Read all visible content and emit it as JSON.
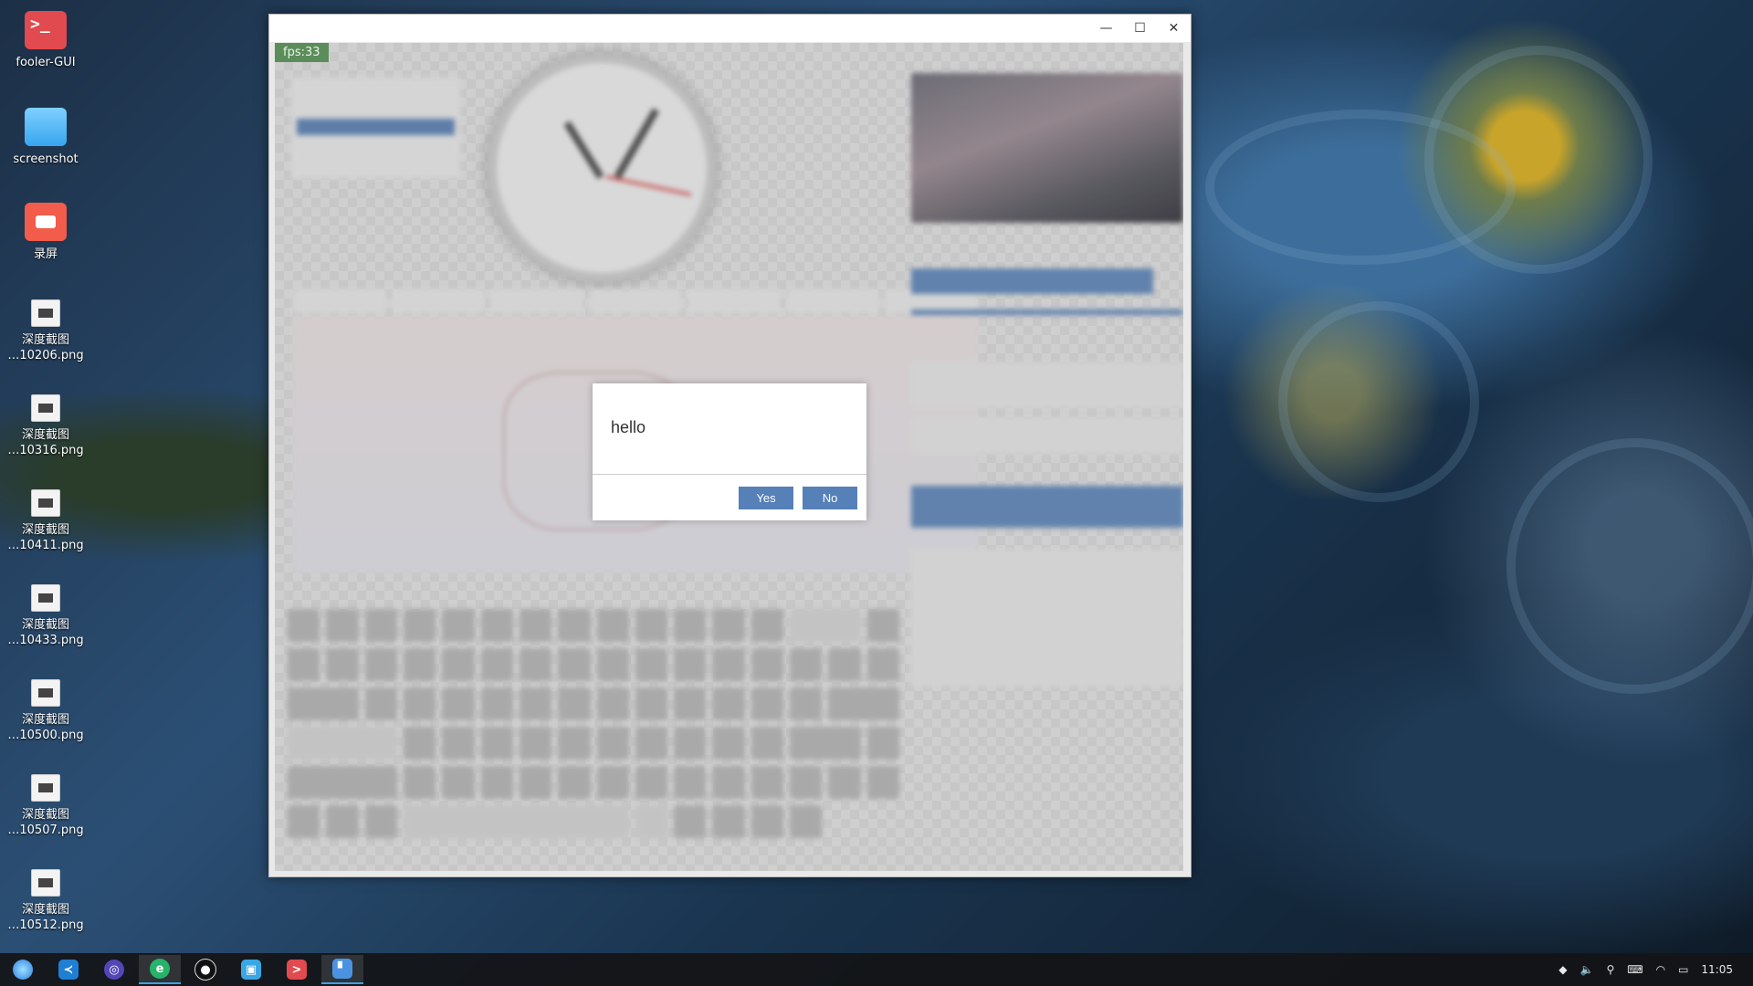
{
  "desktop": {
    "icons": [
      {
        "label_1": "fooler-GUI",
        "label_2": ""
      },
      {
        "label_1": "screenshot",
        "label_2": ""
      },
      {
        "label_1": "录屏",
        "label_2": ""
      },
      {
        "label_1": "深度截图",
        "label_2": "…10206.png"
      },
      {
        "label_1": "深度截图",
        "label_2": "…10316.png"
      },
      {
        "label_1": "深度截图",
        "label_2": "…10411.png"
      },
      {
        "label_1": "深度截图",
        "label_2": "…10433.png"
      },
      {
        "label_1": "深度截图",
        "label_2": "…10500.png"
      },
      {
        "label_1": "深度截图",
        "label_2": "…10507.png"
      },
      {
        "label_1": "深度截图",
        "label_2": "…10512.png"
      }
    ]
  },
  "window": {
    "minimize_glyph": "—",
    "maximize_glyph": "☐",
    "close_glyph": "✕",
    "fps_label": "fps:33"
  },
  "dialog": {
    "message": "hello",
    "yes_label": "Yes",
    "no_label": "No"
  },
  "taskbar": {
    "apps": [
      "launcher",
      "vscode",
      "deepin-assistant",
      "browser",
      "qq",
      "app-store",
      "terminal",
      "fooler-gui"
    ],
    "clock": "11:05"
  },
  "colors": {
    "dialog_button": "#5580b8",
    "fps_badge": "#5b8d5a",
    "taskbar_bg": "#141416"
  }
}
